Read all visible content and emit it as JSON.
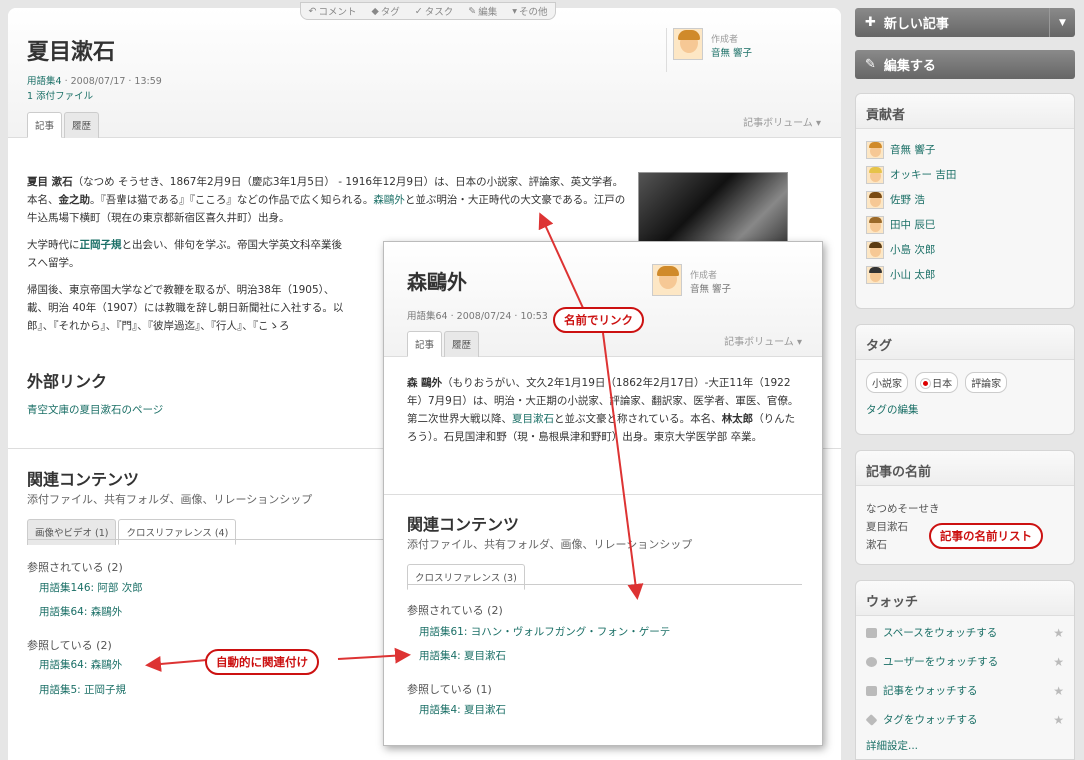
{
  "toolbar": {
    "comment": "コメント",
    "tag": "タグ",
    "task": "タスク",
    "edit": "編集",
    "more": "その他"
  },
  "article": {
    "title": "夏目漱石",
    "collection": "用語集4",
    "date": "· 2008/07/17 · 13:59",
    "attachment": "1 添付ファイル",
    "author_label": "作成者",
    "author_name": "音無 響子",
    "tab_article": "記事",
    "tab_history": "履歴",
    "volume": "記事ボリューム",
    "p1_a": "夏目 漱石",
    "p1_b": "（なつめ そうせき、1867年2月9日（慶応3年1月5日） - 1916年12月9日）は、日本の小説家、評論家、英文学者。本名、",
    "p1_c": "金之助",
    "p1_d": "。『吾輩は猫である』『こころ』などの作品で広く知られる。",
    "p1_link": "森鷗外",
    "p1_e": "と並ぶ明治・大正時代の大文豪である。江戸の牛込馬場下横町（現在の東京都新宿区喜久井町）出身。",
    "p2_a": "大学時代に",
    "p2_link": "正岡子規",
    "p2_b": "と出会い、俳句を学ぶ。帝国大学英文科卒業後",
    "p2_c": "スへ留学。",
    "p3_a": "帰国後、東京帝国大学などで教鞭を取るが、明治38年（1905）、",
    "p3_b": "載、明治 40年（1907）には教職を辞し朝日新聞社に入社する。以",
    "p3_c": "郎』、『それから』、『門』、『彼岸過迄』、『行人』、『こゝろ",
    "ext_title": "外部リンク",
    "ext_link": "青空文庫の夏目漱石のページ",
    "rel_title": "関連コンテンツ",
    "rel_sub": "添付ファイル、共有フォルダ、画像、リレーションシップ",
    "rel_tab1": "画像やビデオ (1)",
    "rel_tab2": "クロスリファレンス (4)",
    "referenced_by": "参照されている (2)",
    "ref1": "用語集146: 阿部 次郎",
    "ref2": "用語集64: 森鷗外",
    "references": "参照している (2)",
    "ref3": "用語集64: 森鷗外",
    "ref4": "用語集5: 正岡子規"
  },
  "popup": {
    "title": "森鷗外",
    "meta": "用語集64 · 2008/07/24 · 10:53",
    "author_label": "作成者",
    "author_name": "音無 響子",
    "tab_article": "記事",
    "tab_history": "履歴",
    "volume": "記事ボリューム",
    "p_a": "森 鷗外",
    "p_b": "（もりおうがい、文久2年1月19日（1862年2月17日）-大正11年（1922年）7月9日）は、明治・大正期の小説家、評論家、翻訳家、医学者、軍医、官僚。第二次世界大戦以降、",
    "p_link": "夏目漱石",
    "p_c": "と並ぶ文豪と称されている。本名、",
    "p_d": "林太郎",
    "p_e": "（りんたろう）。石見国津和野（現・島根県津和野町）出身。東京大学医学部 卒業。",
    "rel_title": "関連コンテンツ",
    "rel_sub": "添付ファイル、共有フォルダ、画像、リレーションシップ",
    "rel_tab": "クロスリファレンス (3)",
    "referenced_by": "参照されている (2)",
    "ref1": "用語集61: ヨハン・ヴォルフガング・フォン・ゲーテ",
    "ref2": "用語集4: 夏目漱石",
    "references": "参照している (1)",
    "ref3": "用語集4: 夏目漱石"
  },
  "callouts": {
    "name_link": "名前でリンク",
    "auto_link": "自動的に関連付け",
    "name_list": "記事の名前リスト"
  },
  "sidebar": {
    "new_article": "新しい記事",
    "edit": "編集する",
    "contributors_title": "貢献者",
    "contributors": [
      "音無 響子",
      "オッキー 吉田",
      "佐野 浩",
      "田中 辰巳",
      "小島 次郎",
      "小山 太郎"
    ],
    "tags_title": "タグ",
    "tags": [
      "小説家",
      "日本",
      "評論家"
    ],
    "tag_edit": "タグの編集",
    "names_title": "記事の名前",
    "names": [
      "なつめそーせき",
      "夏目漱石",
      "漱石"
    ],
    "watch_title": "ウォッチ",
    "watch": [
      "スペースをウォッチする",
      "ユーザーをウォッチする",
      "記事をウォッチする",
      "タグをウォッチする"
    ],
    "detail_settings": "詳細設定..."
  }
}
